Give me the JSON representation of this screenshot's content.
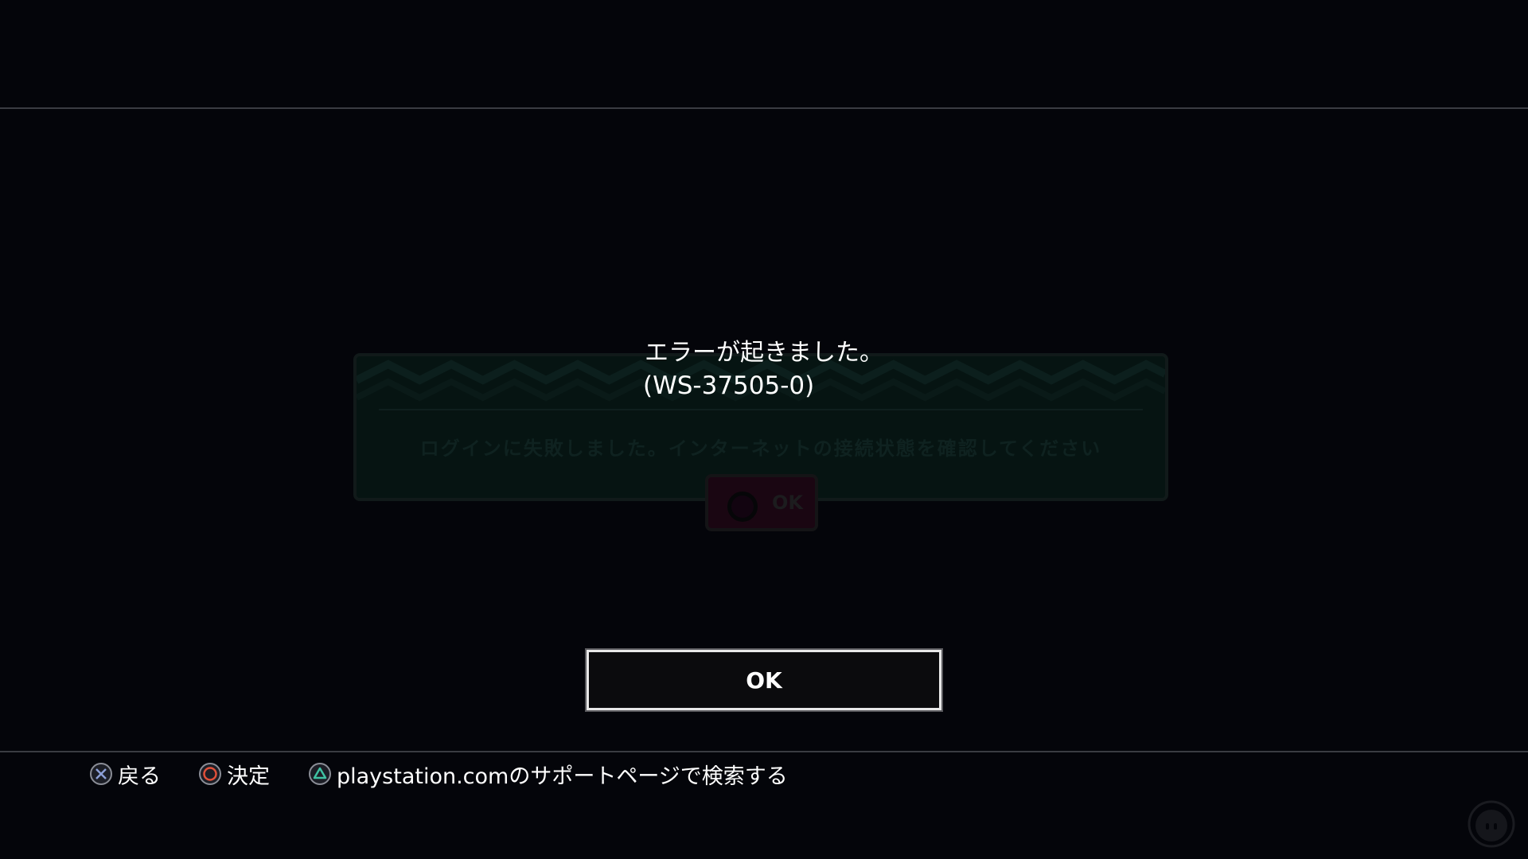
{
  "background_dialog": {
    "message": "ログインに失敗しました。インターネットの接続状態を確認してください",
    "ok_label": "OK"
  },
  "error": {
    "title": "エラーが起きました。",
    "code": "(WS-37505-0)"
  },
  "ok_button": {
    "label": "OK"
  },
  "footer": {
    "back": {
      "icon": "cross-button-icon",
      "label": "戻る"
    },
    "confirm": {
      "icon": "circle-button-icon",
      "label": "決定"
    },
    "search": {
      "icon": "triangle-button-icon",
      "label": "playstation.comのサポートページで検索する"
    }
  },
  "colors": {
    "background": "#04050a",
    "cross": "#8c9fd6",
    "circle": "#e0503a",
    "triangle": "#3fc1a2"
  }
}
